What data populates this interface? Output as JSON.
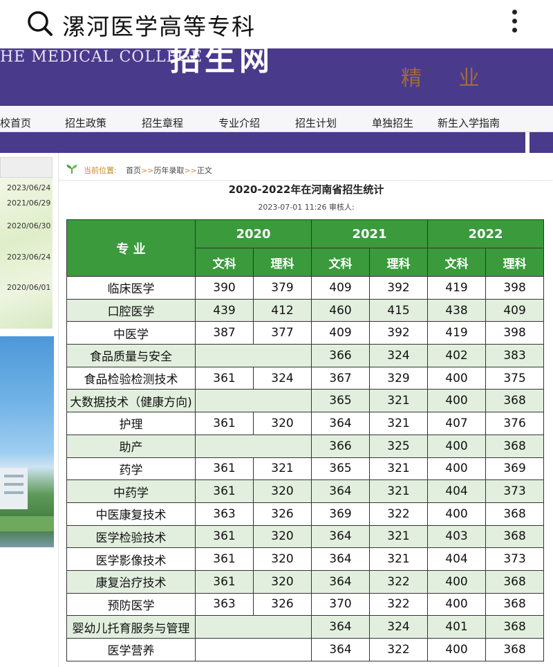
{
  "search": {
    "query": "漯河医学高等专科",
    "search_icon": "search-icon",
    "more_icon": "more-vertical-icon"
  },
  "banner": {
    "english": "HE MEDICAL COLLEGE",
    "chinese_partial": "招生网",
    "calligraphy": "精 业"
  },
  "nav": {
    "items": [
      "校首页",
      "招生政策",
      "招生章程",
      "专业介绍",
      "招生计划",
      "单独招生",
      "新生入学指南"
    ]
  },
  "sidebar": {
    "dates": [
      "2023/06/24",
      "2021/06/29",
      "2020/06/30",
      "2023/06/24",
      "2020/06/01"
    ]
  },
  "breadcrumb": {
    "label": "当前位置:",
    "items": [
      "首页",
      "历年录取",
      "正文"
    ],
    "separator": ">>"
  },
  "article": {
    "title": "2020-2022年在河南省招生统计",
    "meta": "2023-07-01 11:26   审核人:"
  },
  "table": {
    "major_header": "专 业",
    "years": [
      "2020",
      "2021",
      "2022"
    ],
    "subheaders": [
      "文科",
      "理科"
    ],
    "rows": [
      {
        "major": "临床医学",
        "v": [
          "390",
          "379",
          "409",
          "392",
          "419",
          "398"
        ]
      },
      {
        "major": "口腔医学",
        "v": [
          "439",
          "412",
          "460",
          "415",
          "438",
          "409"
        ]
      },
      {
        "major": "中医学",
        "v": [
          "387",
          "377",
          "409",
          "392",
          "419",
          "398"
        ]
      },
      {
        "major": "食品质量与安全",
        "v": [
          "",
          "",
          "366",
          "324",
          "402",
          "383"
        ]
      },
      {
        "major": "食品检验检测技术",
        "v": [
          "361",
          "324",
          "367",
          "329",
          "400",
          "375"
        ]
      },
      {
        "major": "大数据技术（健康方向)",
        "v": [
          "",
          "",
          "365",
          "321",
          "400",
          "368"
        ]
      },
      {
        "major": "护理",
        "v": [
          "361",
          "320",
          "364",
          "321",
          "407",
          "376"
        ]
      },
      {
        "major": "助产",
        "v": [
          "",
          "",
          "366",
          "325",
          "400",
          "368"
        ]
      },
      {
        "major": "药学",
        "v": [
          "361",
          "321",
          "365",
          "321",
          "400",
          "369"
        ]
      },
      {
        "major": "中药学",
        "v": [
          "361",
          "320",
          "364",
          "321",
          "404",
          "373"
        ]
      },
      {
        "major": "中医康复技术",
        "v": [
          "363",
          "326",
          "369",
          "322",
          "400",
          "368"
        ]
      },
      {
        "major": "医学检验技术",
        "v": [
          "361",
          "320",
          "364",
          "321",
          "403",
          "368"
        ]
      },
      {
        "major": "医学影像技术",
        "v": [
          "361",
          "320",
          "364",
          "321",
          "404",
          "373"
        ]
      },
      {
        "major": "康复治疗技术",
        "v": [
          "361",
          "320",
          "364",
          "322",
          "400",
          "368"
        ]
      },
      {
        "major": "预防医学",
        "v": [
          "363",
          "326",
          "370",
          "322",
          "400",
          "368"
        ]
      },
      {
        "major": "婴幼儿托育服务与管理",
        "v": [
          "",
          "",
          "364",
          "324",
          "401",
          "368"
        ]
      },
      {
        "major": "医学营养",
        "v": [
          "",
          "",
          "364",
          "322",
          "400",
          "368"
        ]
      }
    ]
  },
  "colors": {
    "banner": "#4a3a8c",
    "table_header": "#3a9a3c",
    "row_alt": "#e2efde"
  }
}
